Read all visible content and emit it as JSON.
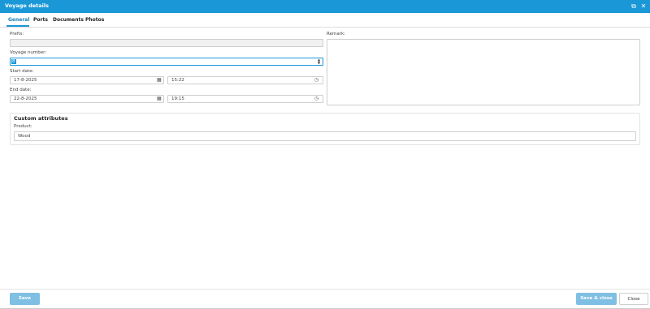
{
  "window": {
    "title": "Voyage details",
    "restore_icon": "⧉",
    "close_icon": "✕"
  },
  "tabs": [
    {
      "label": "General"
    },
    {
      "label": "Ports"
    },
    {
      "label": "Documents"
    },
    {
      "label": "Photos"
    }
  ],
  "form": {
    "prefix": {
      "label": "Prefix:",
      "value": ""
    },
    "voyage_number": {
      "label": "Voyage number:",
      "value": "8"
    },
    "start_date": {
      "label": "Start date:",
      "date": "17-8-2025",
      "time": "15:22"
    },
    "end_date": {
      "label": "End date:",
      "date": "22-8-2025",
      "time": "19:15"
    },
    "remark": {
      "label": "Remark:",
      "value": ""
    }
  },
  "custom_attributes": {
    "title": "Custom attributes",
    "product": {
      "label": "Product:",
      "value": "Wood"
    }
  },
  "footer": {
    "save_label": "Save",
    "save_close_label": "Save & close",
    "close_label": "Close"
  }
}
